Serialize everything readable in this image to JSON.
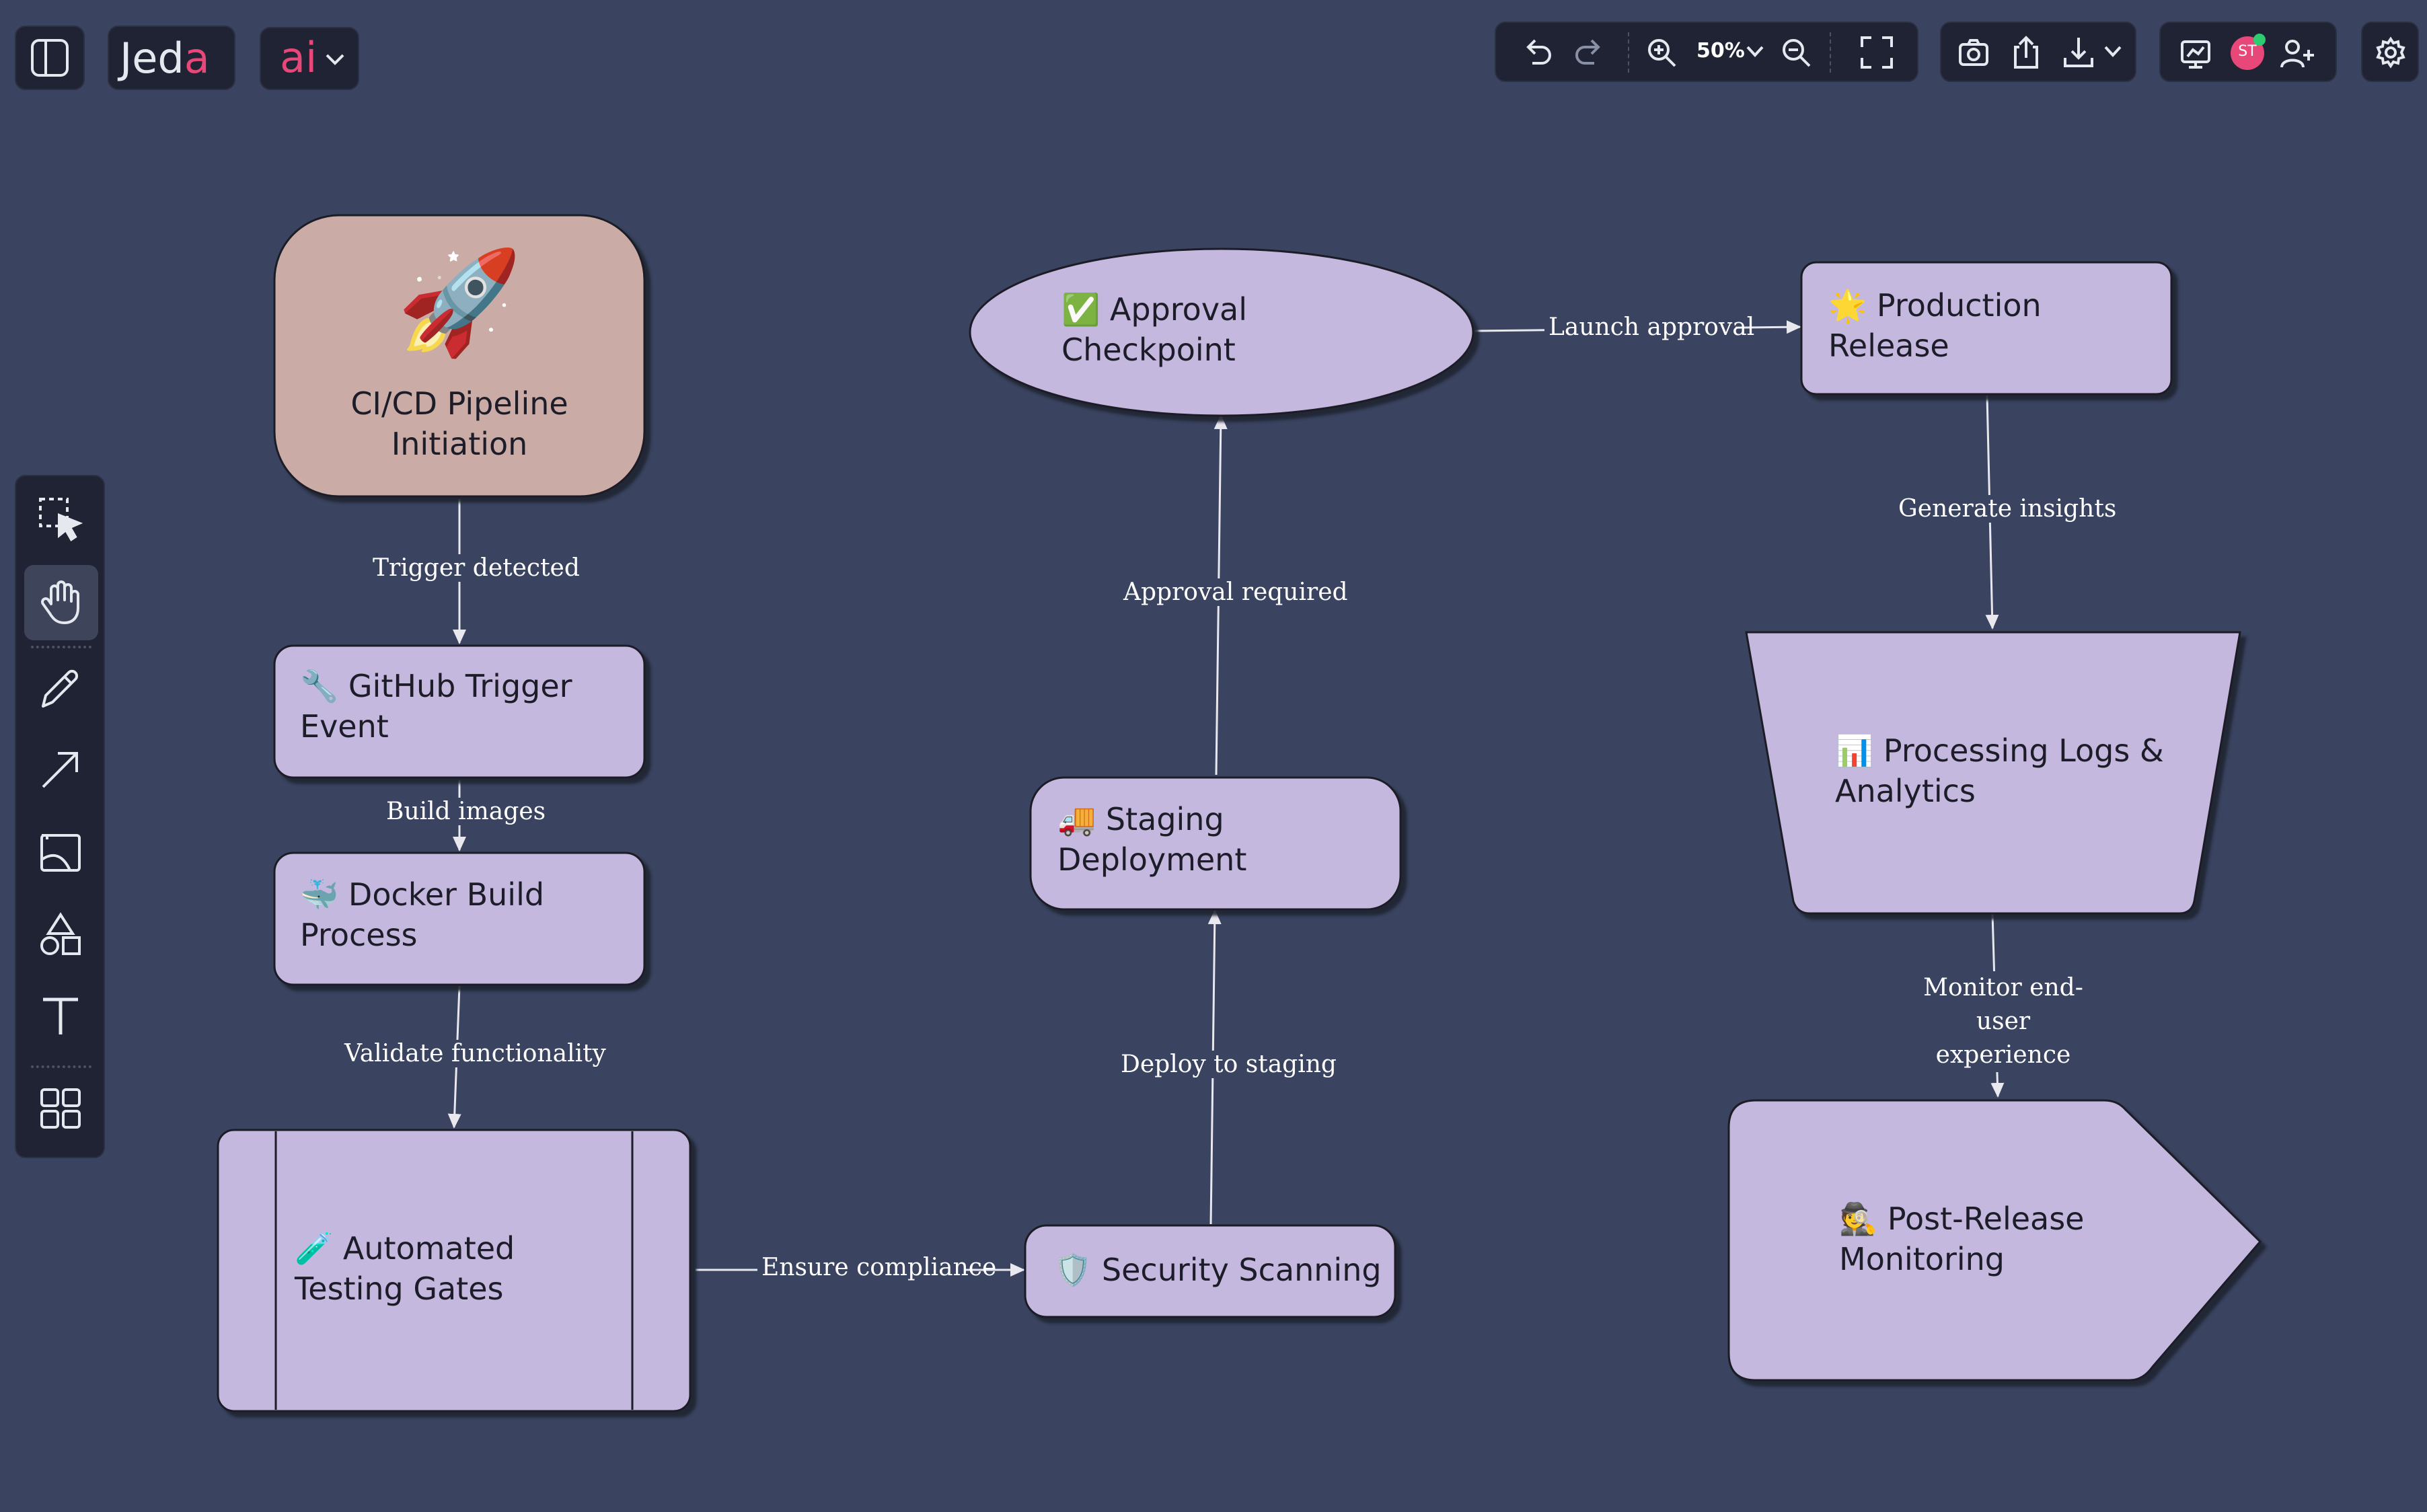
{
  "app": {
    "logo_text": "Jed",
    "logo_accent": "a",
    "ai_label": "ai",
    "zoom": "50%",
    "user_initials": "ST"
  },
  "colors": {
    "background": "#3a4460",
    "toolbar_bg": "#1f2333",
    "accent_pink": "#e8477a",
    "node_fill": "#c4b8de",
    "start_node_fill": "#caaba6",
    "status_green": "#2ecc71"
  },
  "toolbar_top": {
    "icons": [
      "sidebar-toggle-icon",
      "undo-icon",
      "redo-icon",
      "zoom-in-icon",
      "chevron-down-icon",
      "zoom-out-icon",
      "fullscreen-icon",
      "camera-icon",
      "share-icon",
      "download-icon",
      "present-icon",
      "add-user-icon",
      "settings-icon"
    ]
  },
  "toolbar_left": {
    "tools": [
      "select-tool",
      "hand-tool",
      "pencil-tool",
      "arrow-tool",
      "image-tool",
      "shapes-tool",
      "text-tool",
      "templates-tool"
    ],
    "active": "hand-tool"
  },
  "diagram": {
    "nodes": {
      "start": {
        "emoji": "🚀",
        "label": "CI/CD Pipeline Initiation"
      },
      "github": {
        "emoji": "🔧",
        "label": "GitHub Trigger Event"
      },
      "docker": {
        "emoji": "🐳",
        "label": "Docker Build Process"
      },
      "testing": {
        "emoji": "🧪",
        "label": "Automated Testing Gates"
      },
      "security": {
        "emoji": "🛡️",
        "label": "Security Scanning"
      },
      "staging": {
        "emoji": "🚚",
        "label": "Staging Deployment"
      },
      "approval": {
        "emoji": "✅",
        "label": "Approval Checkpoint"
      },
      "production": {
        "emoji": "🌟",
        "label": "Production Release"
      },
      "logs": {
        "emoji": "📊",
        "label": "Processing Logs & Analytics"
      },
      "monitoring": {
        "emoji": "🕵️",
        "label": "Post-Release Monitoring"
      }
    },
    "edges": {
      "e1": "Trigger detected",
      "e2": "Build images",
      "e3": "Validate functionality",
      "e4": "Ensure compliance",
      "e5": "Deploy to staging",
      "e6": "Approval required",
      "e7": "Launch approval",
      "e8": "Generate insights",
      "e9": "Monitor end-user experience"
    }
  }
}
